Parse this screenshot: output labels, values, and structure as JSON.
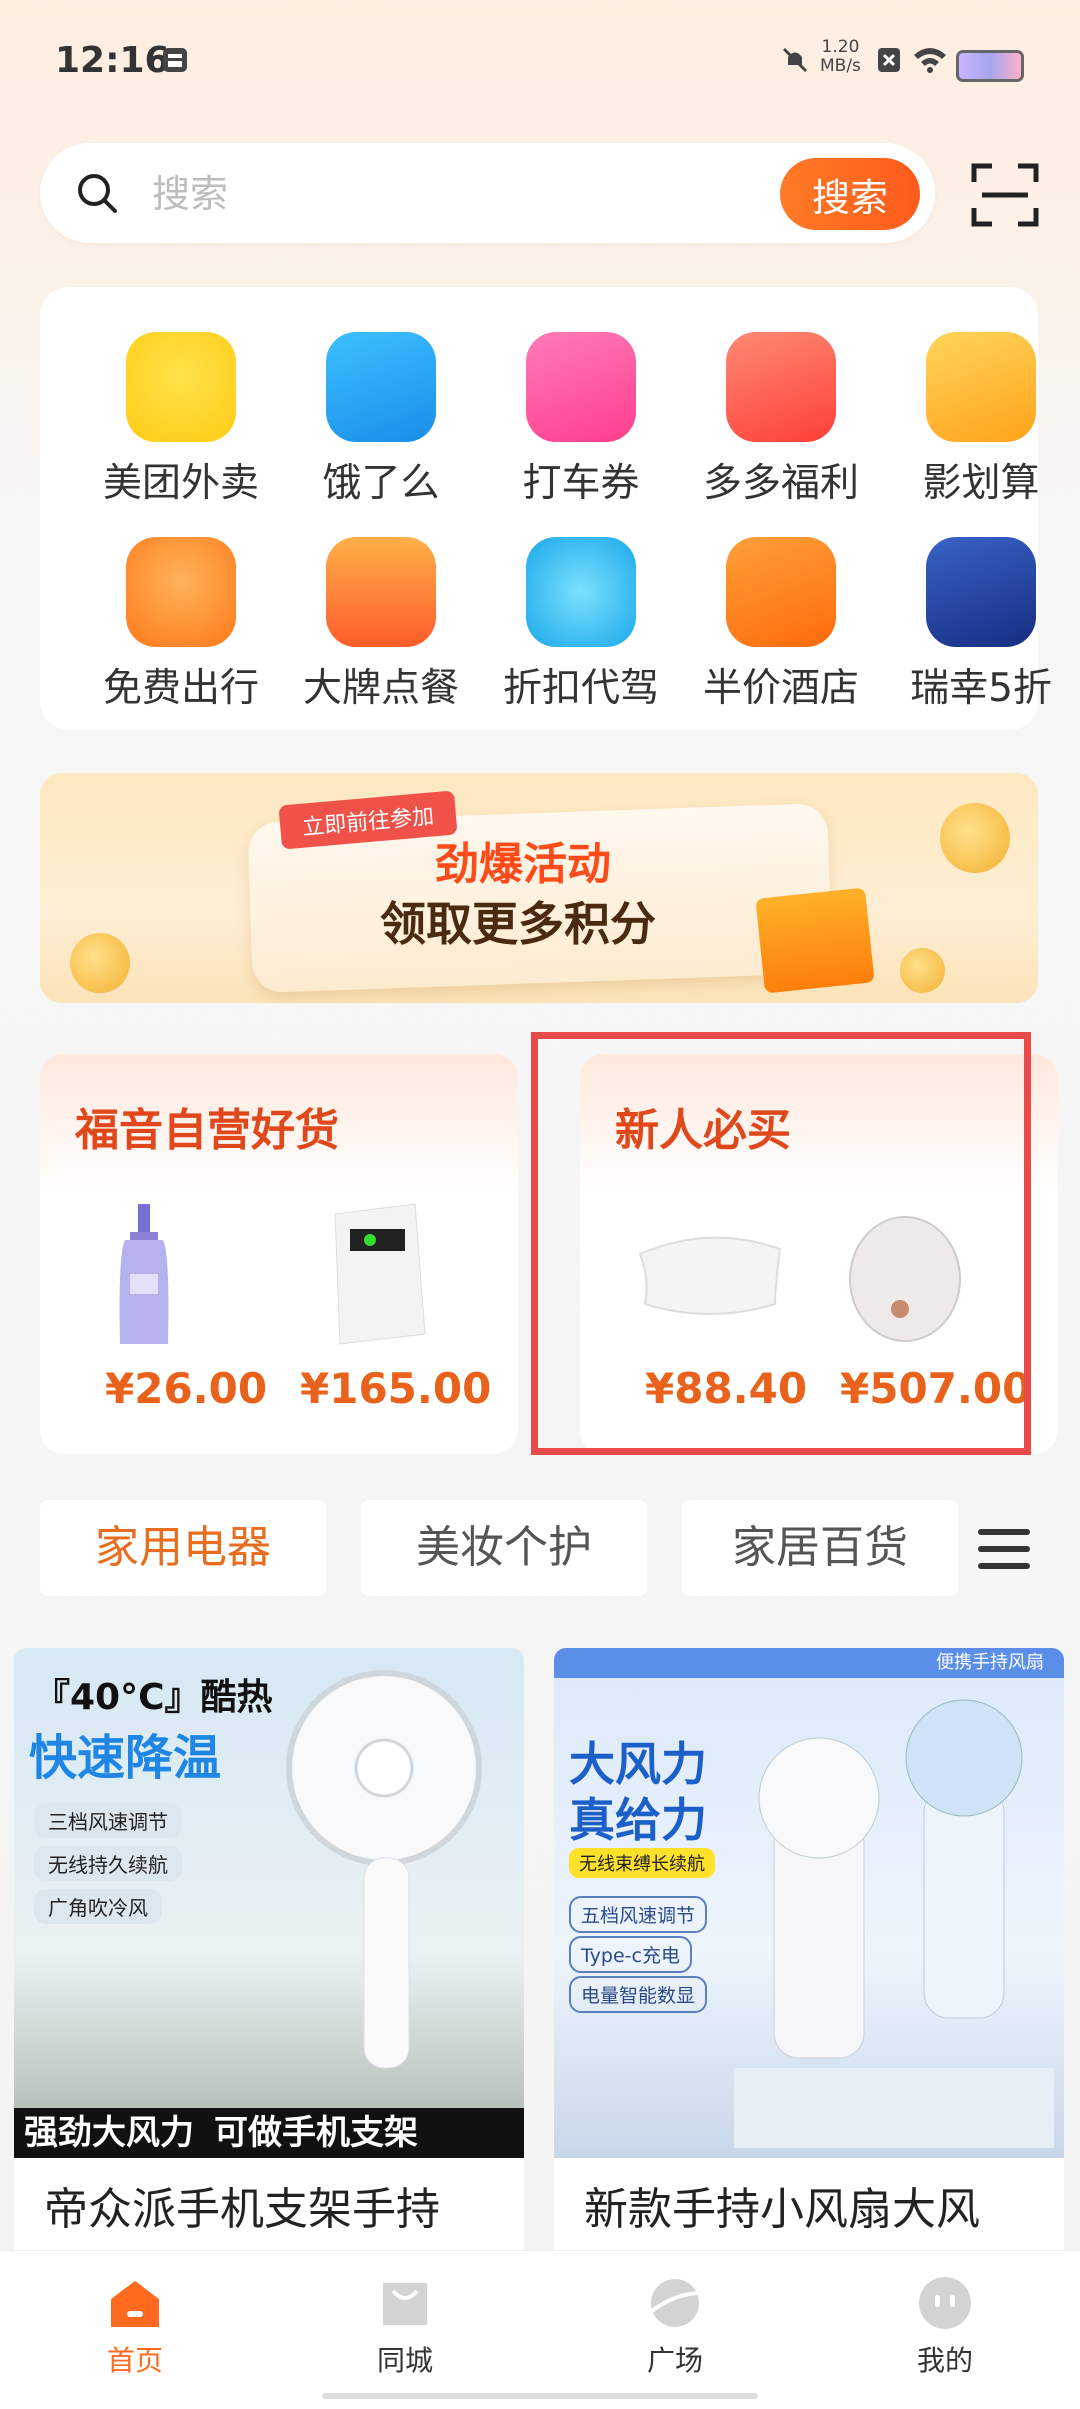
{
  "status": {
    "time": "12:16",
    "net_speed_value": "1.20",
    "net_speed_unit": "MB/s"
  },
  "search": {
    "placeholder": "搜索",
    "button": "搜索"
  },
  "grid": [
    {
      "label": "美团外卖",
      "icon": "meituan-icon",
      "color": "#ffd21f"
    },
    {
      "label": "饿了么",
      "icon": "eleme-icon",
      "color": "#1e9cf0"
    },
    {
      "label": "打车券",
      "icon": "taxi-coupon-icon",
      "color": "#ff4f9a"
    },
    {
      "label": "多多福利",
      "icon": "gift-bag-icon",
      "color": "#ff5a4a"
    },
    {
      "label": "影划算",
      "icon": "movie-ticket-icon",
      "color": "#ffb21e"
    },
    {
      "label": "免费出行",
      "icon": "location-pin-icon",
      "color": "#ff8a1e"
    },
    {
      "label": "大牌点餐",
      "icon": "burger-icon",
      "color": "#ff7a2a"
    },
    {
      "label": "折扣代驾",
      "icon": "steering-wheel-icon",
      "color": "#25b5ef"
    },
    {
      "label": "半价酒店",
      "icon": "hotel-icon",
      "color": "#ff7b1a"
    },
    {
      "label": "瑞幸5折",
      "icon": "coffee-cup-icon",
      "color": "#1d3a96"
    }
  ],
  "banner": {
    "tag": "立即前往参加",
    "line1": "劲爆活动",
    "line2": "领取更多积分"
  },
  "promo_cards": [
    {
      "title": "福音自营好货",
      "products": [
        {
          "name": "shampoo-bottle",
          "price": "¥26.00",
          "color": "#b9b3ef"
        },
        {
          "name": "air-purifier",
          "price": "¥165.00",
          "color": "#e9e9e9"
        }
      ]
    },
    {
      "title": "新人必买",
      "products": [
        {
          "name": "pillow",
          "price": "¥88.40",
          "color": "#efefef"
        },
        {
          "name": "water-heater",
          "price": "¥507.00",
          "color": "#e6e2e0"
        }
      ]
    }
  ],
  "tabs": [
    "家用电器",
    "美妆个护",
    "家居百货"
  ],
  "feed": [
    {
      "title": "帝众派手机支架手持",
      "headline1": "『40°C』酷热",
      "headline2": "快速降温",
      "features": [
        "三档风速调节",
        "无线持久续航",
        "广角吹冷风"
      ],
      "footer": "强劲大风力",
      "footer2": "可做手机支架"
    },
    {
      "title": "新款手持小风扇大风",
      "top_label": "便携手持风扇",
      "headline1": "大风力",
      "headline2": "真给力",
      "badge": "无线束缚长续航",
      "features": [
        "五档风速调节",
        "Type-c充电",
        "电量智能数显"
      ]
    }
  ],
  "nav": [
    {
      "label": "首页",
      "icon": "home-icon",
      "active": true
    },
    {
      "label": "同城",
      "icon": "shopping-bag-icon"
    },
    {
      "label": "广场",
      "icon": "planet-icon"
    },
    {
      "label": "我的",
      "icon": "profile-icon"
    }
  ],
  "colors": {
    "accent": "#ff6a1f",
    "price": "#e8621c",
    "highlight_border": "#e84a4a"
  }
}
